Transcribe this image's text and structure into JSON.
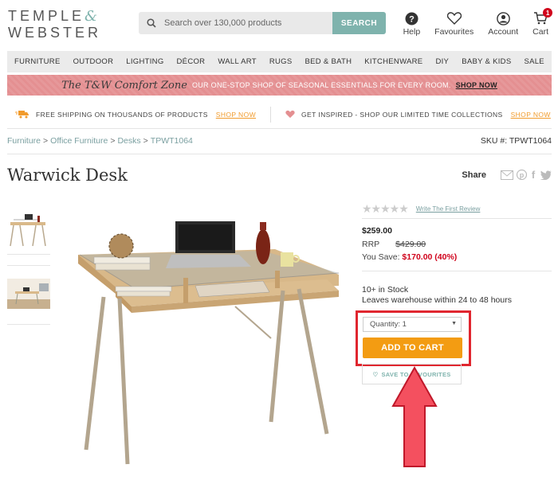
{
  "header": {
    "logo_line1": "TEMPLE",
    "logo_amp": "&",
    "logo_line2": "WEBSTER",
    "search": {
      "placeholder": "Search over 130,000 products",
      "button_label": "SEARCH"
    },
    "links": [
      {
        "label": "Help",
        "icon": "help-icon"
      },
      {
        "label": "Favourites",
        "icon": "heart-icon"
      },
      {
        "label": "Account",
        "icon": "account-icon"
      },
      {
        "label": "Cart",
        "icon": "cart-icon",
        "badge": "1"
      }
    ]
  },
  "nav": [
    "FURNITURE",
    "OUTDOOR",
    "LIGHTING",
    "DÉCOR",
    "WALL ART",
    "RUGS",
    "BED & BATH",
    "KITCHENWARE",
    "DIY",
    "BABY & KIDS",
    "SALE"
  ],
  "promo": {
    "script": "The T&W Comfort Zone",
    "text": "OUR ONE-STOP SHOP OF SEASONAL ESSENTIALS FOR EVERY ROOM.",
    "link": "SHOP NOW"
  },
  "usp": [
    {
      "text": "FREE SHIPPING ON THOUSANDS OF PRODUCTS",
      "link": "SHOP NOW",
      "icon": "truck-icon"
    },
    {
      "text": "GET INSPIRED - SHOP OUR LIMITED TIME COLLECTIONS",
      "link": "SHOP NOW",
      "icon": "heart-icon"
    }
  ],
  "breadcrumb": [
    "Furniture",
    "Office Furniture",
    "Desks",
    "TPWT1064"
  ],
  "breadcrumb_sep": ">",
  "sku": "SKU #: TPWT1064",
  "product": {
    "title": "Warwick Desk",
    "share_label": "Share",
    "rating_link": "Write The First Review",
    "price": "$259.00",
    "rrp_label": "RRP",
    "rrp_value": "$429.00",
    "save_label": "You Save:",
    "save_value": "$170.00 (40%)",
    "stock": "10+ in Stock",
    "leaves": "Leaves warehouse within 24 to 48 hours",
    "quantity_label": "Quantity: 1",
    "add_to_cart": "ADD TO CART",
    "save_fav": "SAVE TO FAVOURITES"
  },
  "colors": {
    "accent": "#7fb3ad",
    "cart_button": "#f39c12",
    "promo": "#e48f91",
    "highlight": "#e0262f",
    "sale_red": "#d0021b"
  }
}
